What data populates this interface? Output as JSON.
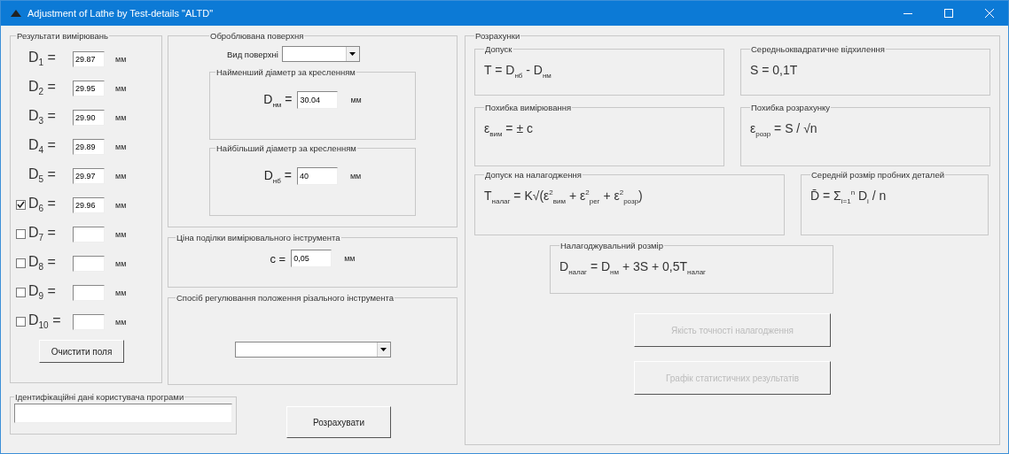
{
  "window": {
    "title": "Adjustment of Lathe by Test-details \"ALTD\""
  },
  "measurements": {
    "title": "Результати вимірювань",
    "items": [
      {
        "label": "D$_{1}$ =",
        "value": "29.87",
        "unit": "мм",
        "kind": "plain"
      },
      {
        "label": "D$_{2}$ =",
        "value": "29.95",
        "unit": "мм",
        "kind": "plain"
      },
      {
        "label": "D$_{3}$ =",
        "value": "29.90",
        "unit": "мм",
        "kind": "plain"
      },
      {
        "label": "D$_{4}$ =",
        "value": "29.89",
        "unit": "мм",
        "kind": "plain"
      },
      {
        "label": "D$_{5}$ =",
        "value": "29.97",
        "unit": "мм",
        "kind": "plain"
      },
      {
        "label": "D$_{6}$ =",
        "value": "29.96",
        "unit": "мм",
        "kind": "checkable",
        "checked": true
      },
      {
        "label": "D$_{7}$ =",
        "unit": "мм",
        "kind": "checkable",
        "checked": false
      },
      {
        "label": "D$_{8}$ =",
        "unit": "мм",
        "kind": "checkable",
        "checked": false
      },
      {
        "label": "D$_{9}$ =",
        "unit": "мм",
        "kind": "checkable",
        "checked": false
      },
      {
        "label": "D$_{10}$ =",
        "unit": "мм",
        "kind": "checkable",
        "checked": false
      }
    ],
    "clear_button": {
      "label": "Очистити поля",
      "disabled": false
    }
  },
  "surface": {
    "title": "Оброблювана поверхня",
    "type_label": "Вид поверхні",
    "min_diameter": {
      "title": "Найменший діаметр за кресленням",
      "label": "D$_{нм}$ =",
      "value": "30.04",
      "unit": "мм"
    },
    "max_diameter": {
      "title": "Найбільший діаметр за кресленням",
      "label": "D$_{нб}$ =",
      "value": "40",
      "unit": "мм"
    }
  },
  "division": {
    "title": "Ціна поділки вимірювального інструмента",
    "label": "c =",
    "value": "0,05",
    "unit": "мм"
  },
  "adjustment_method": {
    "title": "Спосіб регулювання положення різального інструмента"
  },
  "user_id": {
    "title": "Ідентифікаційні дані користувача програми"
  },
  "calculate_button": {
    "label": "Розрахувати",
    "disabled": false
  },
  "calculations": {
    "title": "Розрахунки",
    "formulas": [
      {
        "title": "Допуск",
        "formula": "T = D$_{нб}$ - D$_{нм}$"
      },
      {
        "title": "Середньоквадратичне відхилення",
        "formula": "S = 0,1T"
      },
      {
        "title": "Похибка вимірювання",
        "formula": "ε$_{вим}$ = ± c"
      },
      {
        "title": "Похибка розрахунку",
        "formula": "ε$_{розр}$ = S / √n"
      },
      {
        "title": "Допуск на налагодження",
        "formula": "T$_{налаг}$ = K√(ε$^{2}$$_{вим}$ + ε$^{2}$$_{рег}$ + ε$^{2}$$_{розр}$)"
      },
      {
        "title": "Середній розмір пробних деталей",
        "formula": "D̄ = Σ$_{i=1}$$^{n}$ D$_{i}$ / n"
      },
      {
        "title": "Налагоджувальний розмір",
        "formula": "D$_{налаг}$ = D$_{нм}$ + 3S + 0,5T$_{налаг}$"
      }
    ],
    "buttons": [
      {
        "label": "Якість точності налагодження",
        "disabled": true
      },
      {
        "label": "Графік статистичних результатів",
        "disabled": true
      }
    ]
  }
}
